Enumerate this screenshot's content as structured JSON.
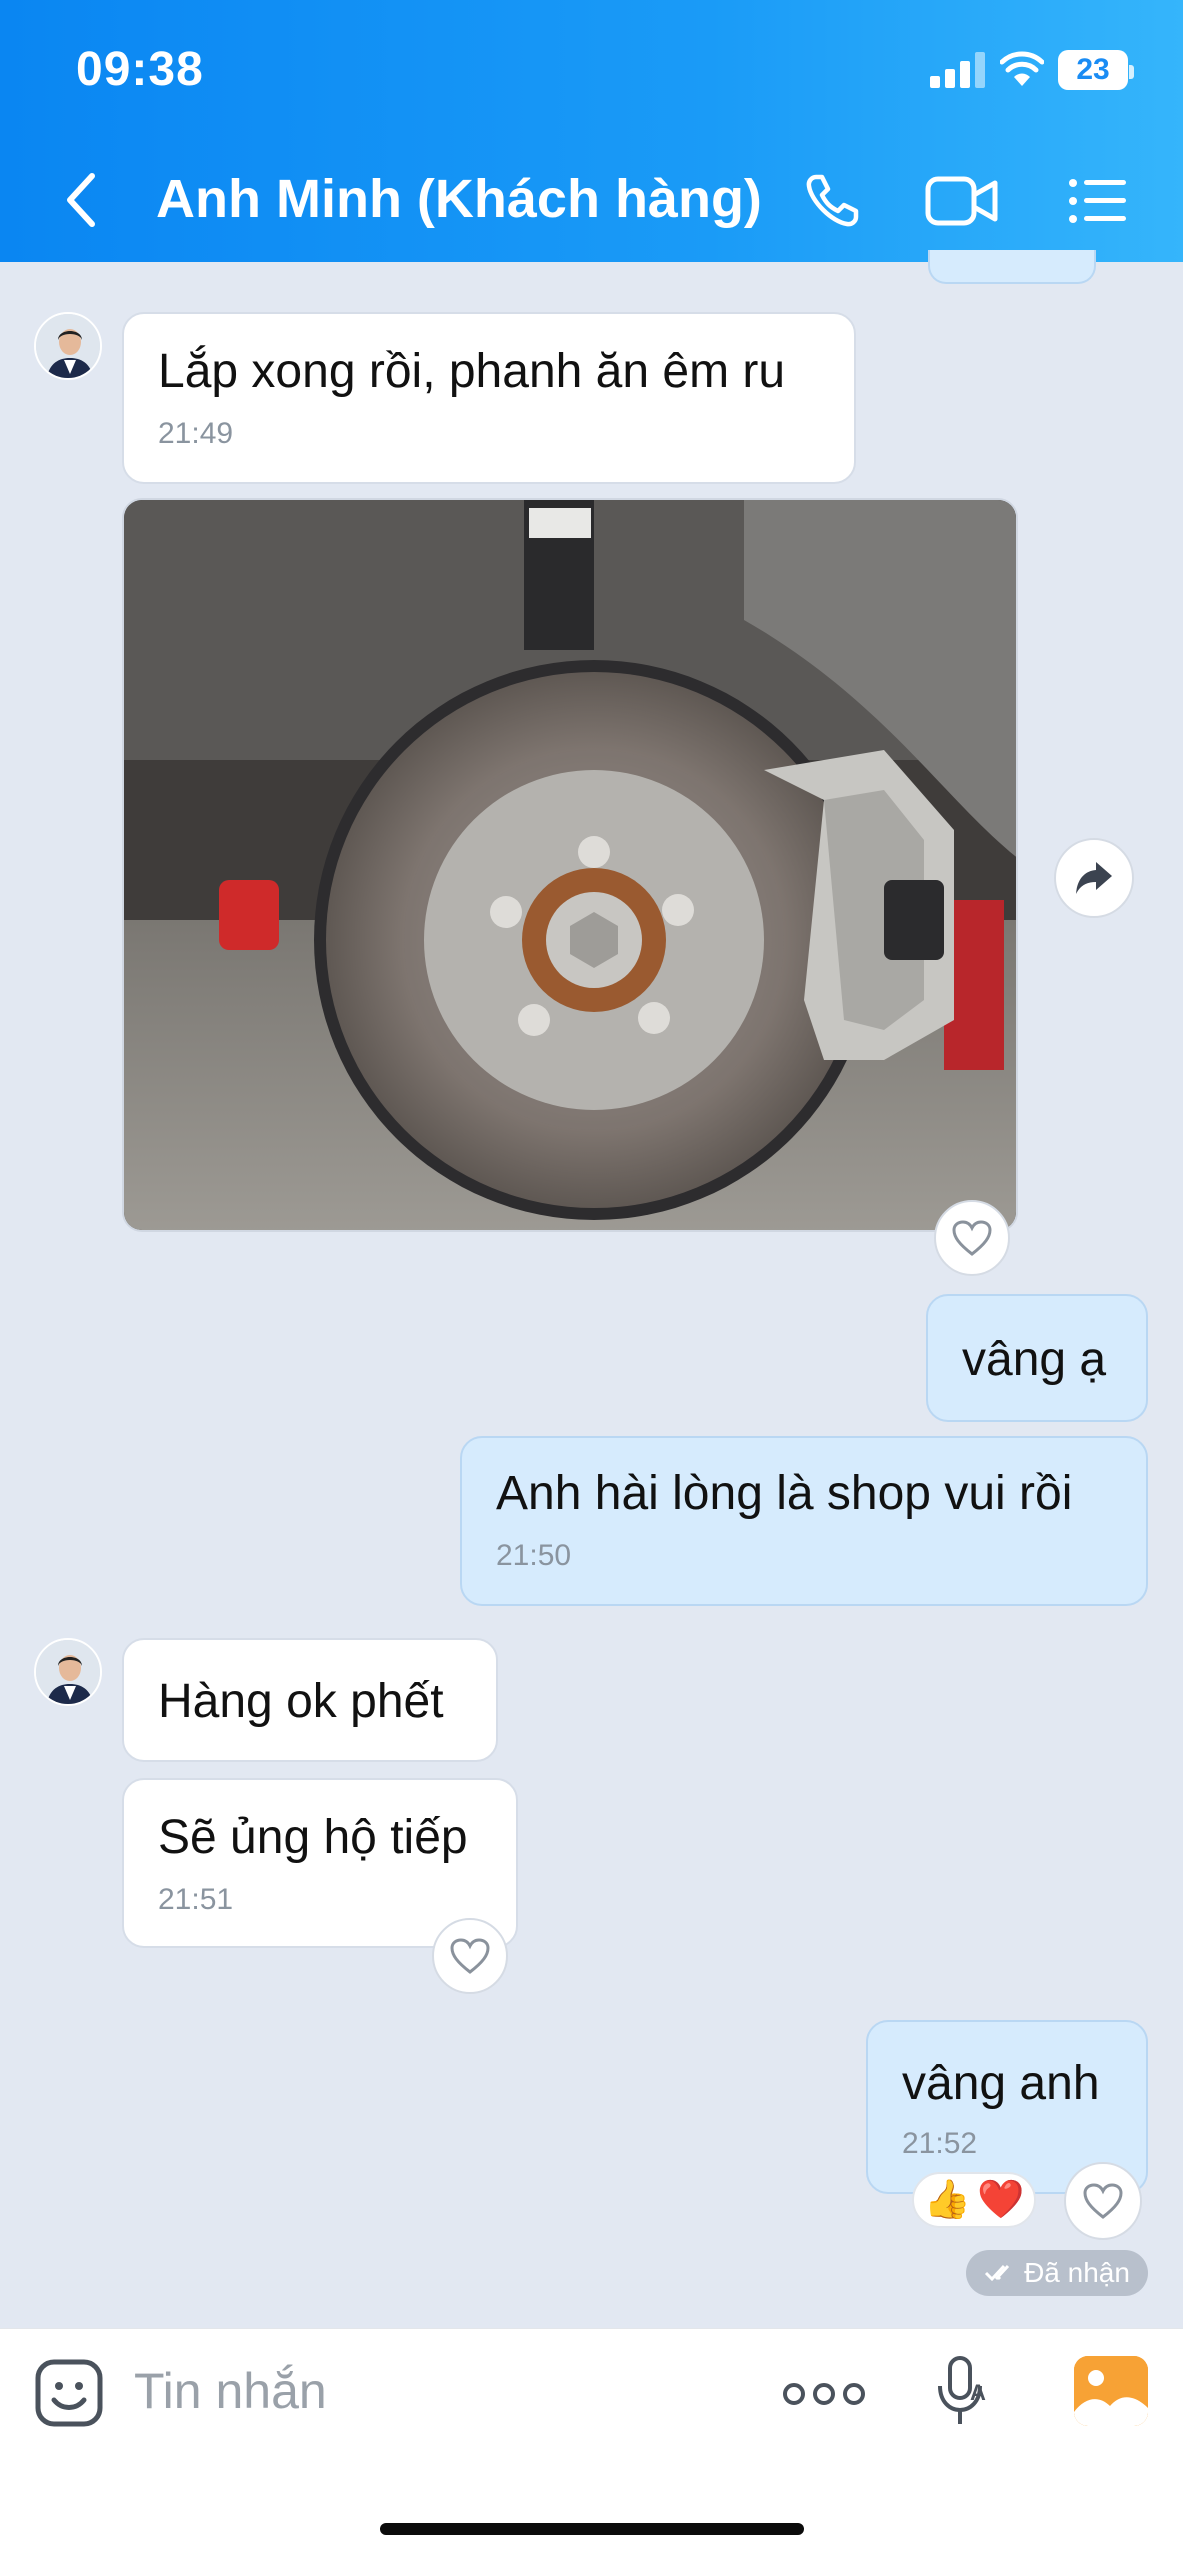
{
  "status_bar": {
    "time": "09:38",
    "battery": "23"
  },
  "header": {
    "title": "Anh Minh (Khách hàng)"
  },
  "messages": [
    {
      "text": "Lắp xong rồi, phanh ăn êm ru",
      "time": "21:49"
    },
    {
      "text": "vâng ạ"
    },
    {
      "text": "Anh hài lòng là shop vui rồi",
      "time": "21:50"
    },
    {
      "text": "Hàng ok phết"
    },
    {
      "text": "Sẽ ủng hộ tiếp",
      "time": "21:51"
    },
    {
      "text": "vâng anh",
      "time": "21:52"
    }
  ],
  "reactions": [
    "👍",
    "❤️"
  ],
  "seen_label": "Đã nhận",
  "composer": {
    "placeholder": "Tin nhắn"
  },
  "colors": {
    "header": "#0a86f2",
    "outgoing_bubble": "#d6ebfd",
    "incoming_bubble": "#ffffff",
    "background": "#e2e8f2"
  }
}
